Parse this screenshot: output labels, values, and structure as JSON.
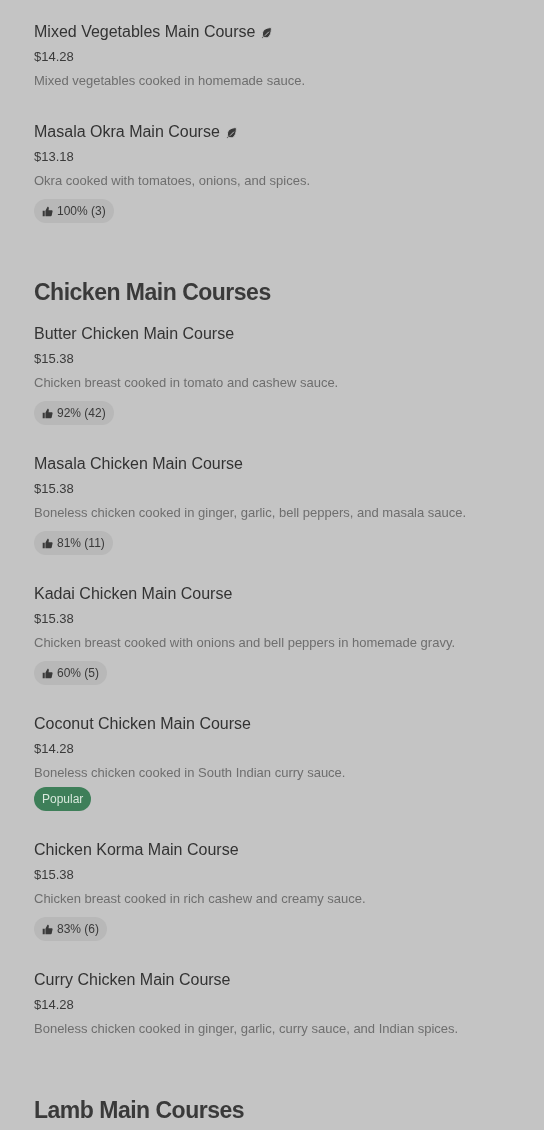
{
  "sections": [
    {
      "items": [
        {
          "name": "Mixed Vegetables Main Course",
          "vegetarian": true,
          "price": "$14.28",
          "description": "Mixed vegetables cooked in homemade sauce."
        },
        {
          "name": "Masala Okra Main Course",
          "vegetarian": true,
          "price": "$13.18",
          "description": "Okra cooked with tomatoes, onions, and spices.",
          "badge": {
            "kind": "rating",
            "text": "100% (3)"
          }
        }
      ]
    },
    {
      "title": "Chicken Main Courses",
      "items": [
        {
          "name": "Butter Chicken Main Course",
          "vegetarian": false,
          "price": "$15.38",
          "description": "Chicken breast cooked in tomato and cashew sauce.",
          "badge": {
            "kind": "rating",
            "text": "92% (42)"
          }
        },
        {
          "name": "Masala Chicken Main Course",
          "vegetarian": false,
          "price": "$15.38",
          "description": "Boneless chicken cooked in ginger, garlic, bell peppers, and masala sauce.",
          "badge": {
            "kind": "rating",
            "text": "81% (11)"
          }
        },
        {
          "name": "Kadai Chicken Main Course",
          "vegetarian": false,
          "price": "$15.38",
          "description": "Chicken breast cooked with onions and bell peppers in homemade gravy.",
          "badge": {
            "kind": "rating",
            "text": "60% (5)"
          }
        },
        {
          "name": "Coconut Chicken Main Course",
          "vegetarian": false,
          "price": "$14.28",
          "description": "Boneless chicken cooked in South Indian curry sauce.",
          "badge": {
            "kind": "popular",
            "text": "Popular"
          }
        },
        {
          "name": "Chicken Korma Main Course",
          "vegetarian": false,
          "price": "$15.38",
          "description": "Chicken breast cooked in rich cashew and creamy sauce.",
          "badge": {
            "kind": "rating",
            "text": "83% (6)"
          }
        },
        {
          "name": "Curry Chicken Main Course",
          "vegetarian": false,
          "price": "$14.28",
          "description": "Boneless chicken cooked in ginger, garlic, curry sauce, and Indian spices."
        }
      ]
    },
    {
      "title": "Lamb Main Courses"
    }
  ]
}
